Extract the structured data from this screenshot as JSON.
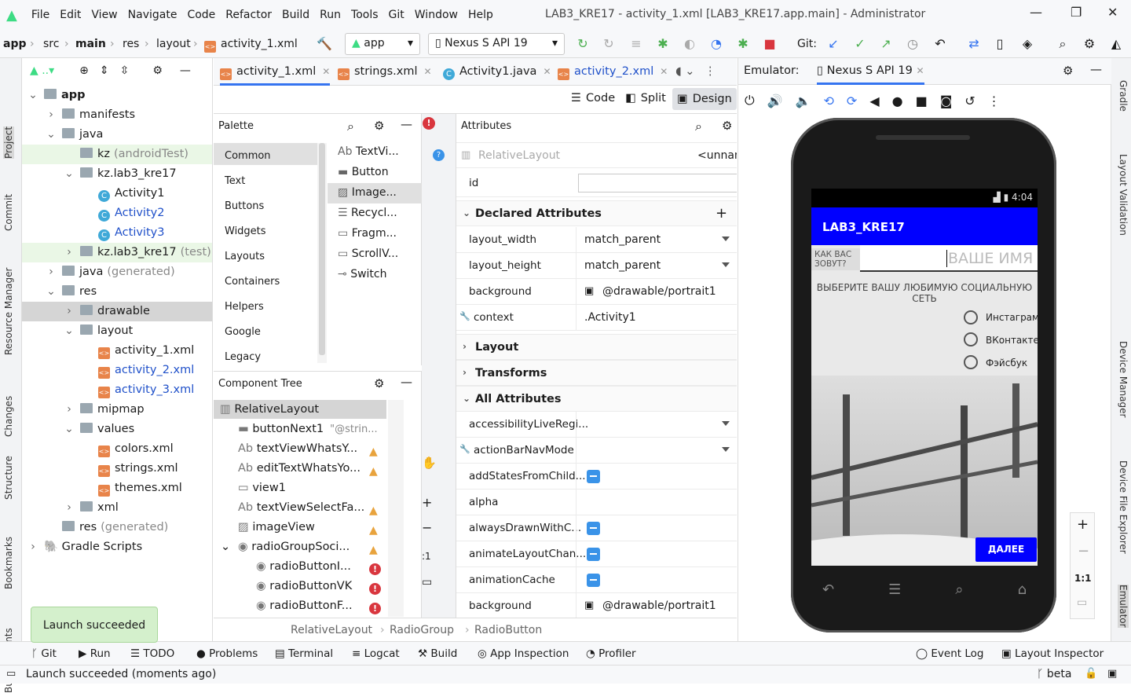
{
  "menu": [
    "File",
    "Edit",
    "View",
    "Navigate",
    "Code",
    "Refactor",
    "Build",
    "Run",
    "Tools",
    "Git",
    "Window",
    "Help"
  ],
  "window_title": "LAB3_KRE17 - activity_1.xml [LAB3_KRE17.app.main] - Administrator",
  "breadcrumb": [
    "app",
    "src",
    "main",
    "res",
    "layout",
    "activity_1.xml"
  ],
  "run_config": "app",
  "device": "Nexus S API 19",
  "git_label": "Git:",
  "left_tabs": [
    "Project",
    "Commit",
    "Resource Manager",
    "Changes",
    "Structure",
    "Bookmarks",
    "Build Variants"
  ],
  "right_tabs": [
    "Gradle",
    "Layout Validation",
    "Device Manager",
    "Device File Explorer",
    "Emulator"
  ],
  "project_tree": [
    {
      "label": "app",
      "indent": 0,
      "arrow": "v",
      "type": "folder"
    },
    {
      "label": "manifests",
      "indent": 1,
      "arrow": ">",
      "type": "folder"
    },
    {
      "label": "java",
      "indent": 1,
      "arrow": "v",
      "type": "folder"
    },
    {
      "label": "kz",
      "suffix": "(androidTest)",
      "indent": 2,
      "arrow": "",
      "type": "folder",
      "style": "green"
    },
    {
      "label": "kz.lab3_kre17",
      "indent": 2,
      "arrow": "v",
      "type": "folder"
    },
    {
      "label": "Activity1",
      "indent": 3,
      "arrow": "",
      "type": "class"
    },
    {
      "label": "Activity2",
      "indent": 3,
      "arrow": "",
      "type": "class",
      "style": "blue"
    },
    {
      "label": "Activity3",
      "indent": 3,
      "arrow": "",
      "type": "class",
      "style": "blue"
    },
    {
      "label": "kz.lab3_kre17",
      "suffix": "(test)",
      "indent": 2,
      "arrow": ">",
      "type": "folder",
      "style": "green"
    },
    {
      "label": "java",
      "suffix": "(generated)",
      "indent": 1,
      "arrow": ">",
      "type": "folder"
    },
    {
      "label": "res",
      "indent": 1,
      "arrow": "v",
      "type": "folder"
    },
    {
      "label": "drawable",
      "indent": 2,
      "arrow": ">",
      "type": "folder",
      "style": "sel"
    },
    {
      "label": "layout",
      "indent": 2,
      "arrow": "v",
      "type": "folder"
    },
    {
      "label": "activity_1.xml",
      "indent": 3,
      "arrow": "",
      "type": "xml"
    },
    {
      "label": "activity_2.xml",
      "indent": 3,
      "arrow": "",
      "type": "xml",
      "style": "blue"
    },
    {
      "label": "activity_3.xml",
      "indent": 3,
      "arrow": "",
      "type": "xml",
      "style": "blue"
    },
    {
      "label": "mipmap",
      "indent": 2,
      "arrow": ">",
      "type": "folder"
    },
    {
      "label": "values",
      "indent": 2,
      "arrow": "v",
      "type": "folder"
    },
    {
      "label": "colors.xml",
      "indent": 3,
      "arrow": "",
      "type": "xml"
    },
    {
      "label": "strings.xml",
      "indent": 3,
      "arrow": "",
      "type": "xml"
    },
    {
      "label": "themes.xml",
      "indent": 3,
      "arrow": "",
      "type": "xml"
    },
    {
      "label": "xml",
      "indent": 2,
      "arrow": ">",
      "type": "folder"
    },
    {
      "label": "res",
      "suffix": "(generated)",
      "indent": 1,
      "arrow": "",
      "type": "folder"
    },
    {
      "label": "Gradle Scripts",
      "indent": 0,
      "arrow": ">",
      "type": "gradle"
    }
  ],
  "editor_tabs": [
    "activity_1.xml",
    "strings.xml",
    "Activity1.java",
    "activity_2.xml"
  ],
  "modes": [
    "Code",
    "Split",
    "Design"
  ],
  "palette": {
    "title": "Palette",
    "categories": [
      "Common",
      "Text",
      "Buttons",
      "Widgets",
      "Layouts",
      "Containers",
      "Helpers",
      "Google",
      "Legacy"
    ],
    "items": [
      "TextVi...",
      "Button",
      "Image...",
      "Recycl...",
      "Fragm...",
      "ScrollV...",
      "Switch"
    ]
  },
  "component_tree": {
    "title": "Component Tree",
    "items": [
      {
        "label": "RelativeLayout",
        "hint": "",
        "indent": 0,
        "flag": ""
      },
      {
        "label": "buttonNext1",
        "hint": "\"@strin...",
        "indent": 1,
        "flag": ""
      },
      {
        "label": "textViewWhatsY...",
        "hint": "",
        "indent": 1,
        "flag": "warn"
      },
      {
        "label": "editTextWhatsYo...",
        "hint": "",
        "indent": 1,
        "flag": "warn"
      },
      {
        "label": "view1",
        "hint": "",
        "indent": 1,
        "flag": ""
      },
      {
        "label": "textViewSelectFa...",
        "hint": "",
        "indent": 1,
        "flag": "warn"
      },
      {
        "label": "imageView",
        "hint": "",
        "indent": 1,
        "flag": "warn"
      },
      {
        "label": "radioGroupSoci...",
        "hint": "",
        "indent": 1,
        "flag": "warn"
      },
      {
        "label": "radioButtonI...",
        "hint": "",
        "indent": 2,
        "flag": "err"
      },
      {
        "label": "radioButtonVK",
        "hint": "",
        "indent": 2,
        "flag": "err"
      },
      {
        "label": "radioButtonF...",
        "hint": "",
        "indent": 2,
        "flag": "err"
      }
    ]
  },
  "attributes": {
    "title": "Attributes",
    "component": "RelativeLayout",
    "component_id": "<unnam",
    "id_label": "id",
    "declared_title": "Declared Attributes",
    "declared": [
      {
        "name": "layout_width",
        "value": "match_parent"
      },
      {
        "name": "layout_height",
        "value": "match_parent"
      },
      {
        "name": "background",
        "value": "@drawable/portrait1"
      },
      {
        "name": "context",
        "value": ".Activity1"
      }
    ],
    "sections": [
      "Layout",
      "Transforms",
      "All Attributes"
    ],
    "all": [
      {
        "name": "accessibilityLiveRegi...",
        "value": "",
        "kind": "dd"
      },
      {
        "name": "actionBarNavMode",
        "value": "",
        "kind": "dd"
      },
      {
        "name": "addStatesFromChild...",
        "value": "",
        "kind": "bool"
      },
      {
        "name": "alpha",
        "value": "",
        "kind": ""
      },
      {
        "name": "alwaysDrawnWithC...",
        "value": "",
        "kind": "bool"
      },
      {
        "name": "animateLayoutChan...",
        "value": "",
        "kind": "bool"
      },
      {
        "name": "animationCache",
        "value": "",
        "kind": "bool"
      },
      {
        "name": "background",
        "value": "@drawable/portrait1",
        "kind": "img"
      }
    ]
  },
  "design_breadcrumb": [
    "RelativeLayout",
    "RadioGroup",
    "RadioButton"
  ],
  "emulator": {
    "label": "Emulator:",
    "tab": "Nexus S API 19",
    "zoom": "1:1"
  },
  "phone": {
    "time": "4:04",
    "app_title": "LAB3_KRE17",
    "ask_label": "КАК ВАС ЗОВУТ?",
    "name_hint": "ВАШЕ ИМЯ",
    "select_label": "ВЫБЕРИТЕ ВАШУ ЛЮБИМУЮ СОЦИАЛЬНУЮ СЕТЬ",
    "options": [
      "Инстаграм",
      "ВКонтакте",
      "Фэйсбук"
    ],
    "next": "ДАЛЕЕ",
    "accent": "#0000ff"
  },
  "bottom_tools": [
    "Git",
    "Run",
    "TODO",
    "Problems",
    "Terminal",
    "Logcat",
    "Build",
    "App Inspection",
    "Profiler",
    "Event Log",
    "Layout Inspector"
  ],
  "toast": "Launch succeeded",
  "status": "Launch succeeded (moments ago)",
  "vcs_branch": "beta"
}
